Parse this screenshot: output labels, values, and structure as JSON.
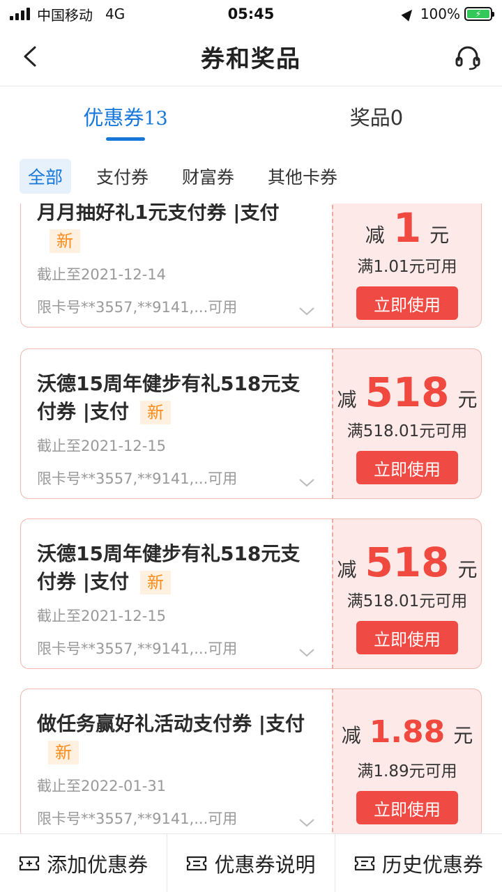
{
  "status_bar": {
    "carrier": "中国移动",
    "network": "4G",
    "time": "05:45",
    "battery": "100%"
  },
  "nav": {
    "title": "券和奖品"
  },
  "tabs": [
    {
      "label": "优惠券",
      "count": "13"
    },
    {
      "label": "奖品",
      "count": "0"
    }
  ],
  "filters": [
    "全部",
    "支付券",
    "财富券",
    "其他卡券"
  ],
  "coupons": [
    {
      "title": "月月抽好礼1元支付券 |支付",
      "badge": "新",
      "expiry": "截止至2021-12-14",
      "card": "限卡号**3557,**9141,...可用",
      "reduce": "减",
      "amount": "1",
      "unit": "元",
      "min_spend": "满1.01元可用",
      "button": "立即使用"
    },
    {
      "title": "沃德15周年健步有礼518元支付券 |支付",
      "badge": "新",
      "expiry": "截止至2021-12-15",
      "card": "限卡号**3557,**9141,...可用",
      "reduce": "减",
      "amount": "518",
      "unit": "元",
      "min_spend": "满518.01元可用",
      "button": "立即使用"
    },
    {
      "title": "沃德15周年健步有礼518元支付券 |支付",
      "badge": "新",
      "expiry": "截止至2021-12-15",
      "card": "限卡号**3557,**9141,...可用",
      "reduce": "减",
      "amount": "518",
      "unit": "元",
      "min_spend": "满518.01元可用",
      "button": "立即使用"
    },
    {
      "title": "做任务赢好礼活动支付券 |支付",
      "badge": "新",
      "expiry": "截止至2022-01-31",
      "card": "限卡号**3557,**9141,...可用",
      "reduce": "减",
      "amount": "1.88",
      "unit": "元",
      "min_spend": "满1.89元可用",
      "button": "立即使用"
    }
  ],
  "bottom_bar": [
    {
      "label": "添加优惠券"
    },
    {
      "label": "优惠券说明"
    },
    {
      "label": "历史优惠券"
    }
  ],
  "colors": {
    "accent": "#1677d8",
    "coupon_red": "#f04a40",
    "coupon_bg": "#fde9e8",
    "badge_orange": "#ff8c1a"
  }
}
